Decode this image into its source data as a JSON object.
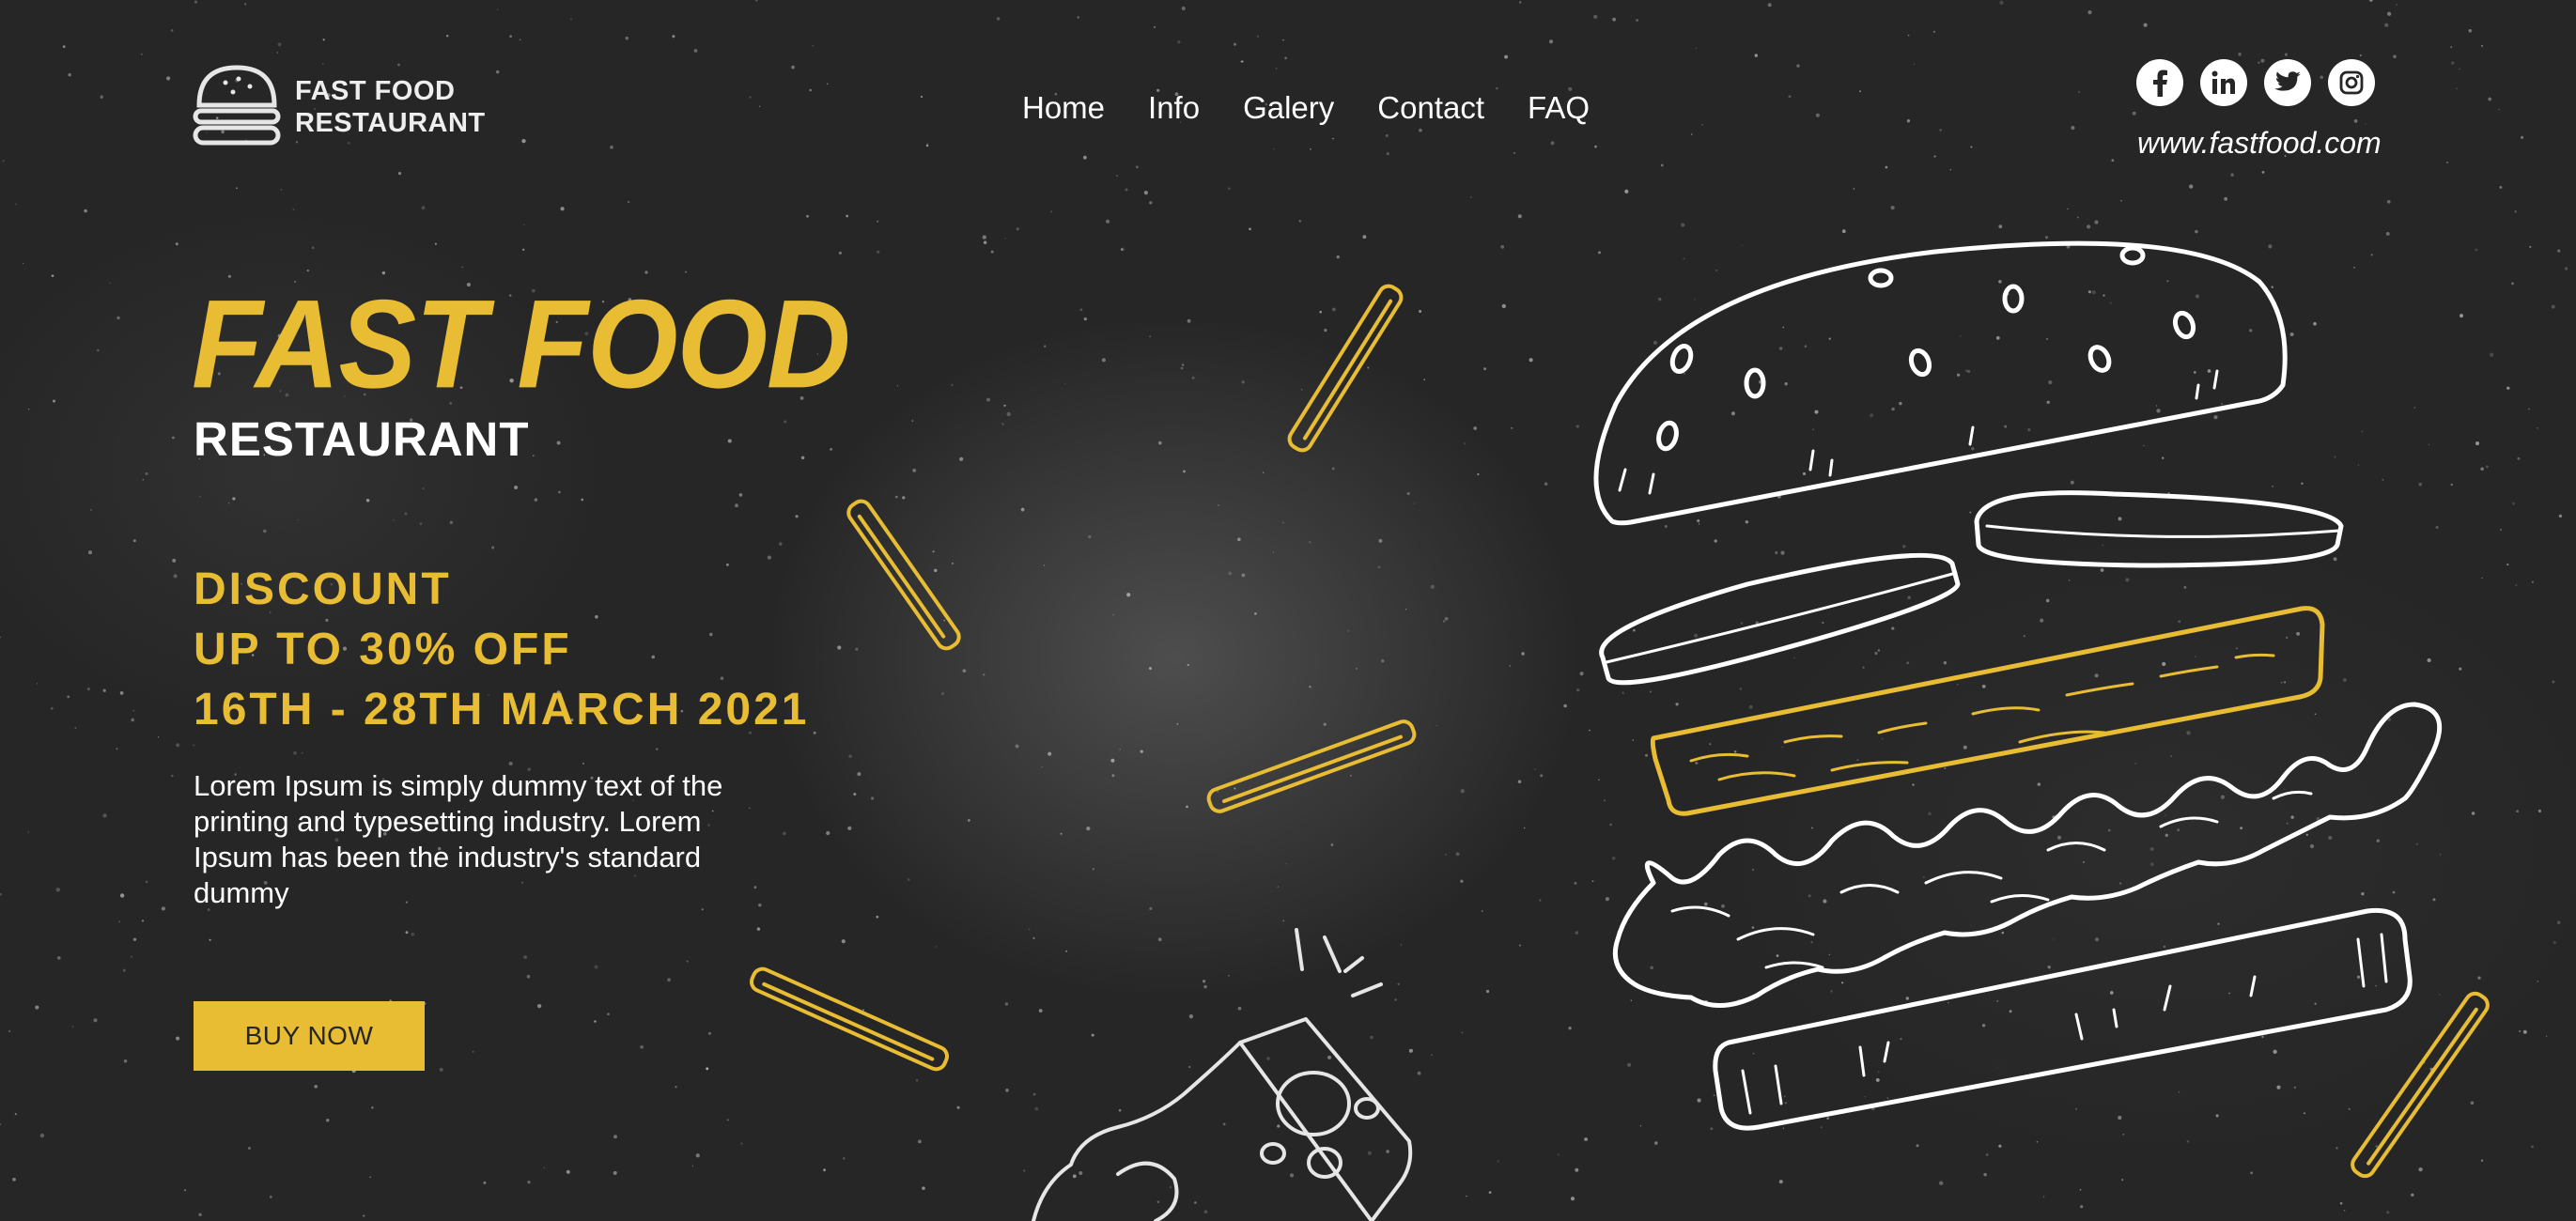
{
  "header": {
    "logo": {
      "line1": "FAST FOOD",
      "line2": "RESTAURANT",
      "icon": "burger-icon"
    },
    "nav": [
      "Home",
      "Info",
      "Galery",
      "Contact",
      "FAQ"
    ],
    "social": [
      {
        "icon": "facebook-icon",
        "glyph": "f"
      },
      {
        "icon": "linkedin-icon",
        "glyph": "in"
      },
      {
        "icon": "twitter-icon",
        "glyph": ""
      },
      {
        "icon": "instagram-icon",
        "glyph": ""
      }
    ],
    "website": "www.fastfood.com"
  },
  "hero": {
    "title": "FAST FOOD",
    "subtitle": "RESTAURANT",
    "discount": [
      "DISCOUNT",
      "UP TO 30% OFF",
      "16TH - 28TH MARCH 2021"
    ],
    "description": "Lorem Ipsum is simply dummy text of the printing and typesetting industry. Lorem Ipsum has been the industry's standard dummy",
    "cta": "BUY NOW"
  },
  "colors": {
    "accent": "#e8bd33",
    "background": "#262626",
    "line": "#ffffff"
  }
}
